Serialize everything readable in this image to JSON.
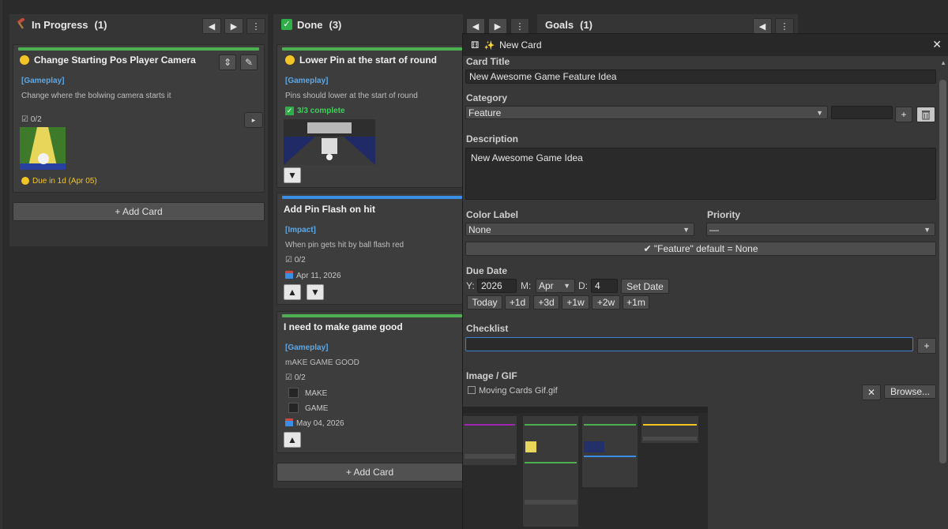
{
  "columns": {
    "in_progress": {
      "icon": "hammer-icon",
      "title": "In Progress",
      "count": "(1)",
      "add_label": "+ Add Card"
    },
    "done": {
      "icon": "checkbox-icon",
      "title": "Done",
      "count": "(3)",
      "add_label": "+ Add Card"
    },
    "goals": {
      "title": "Goals",
      "count": "(1)"
    }
  },
  "nav_glyphs": {
    "left": "◀",
    "right": "▶",
    "menu": "⋮"
  },
  "cards": {
    "camera": {
      "title": "Change Starting Pos Player Camera",
      "tag": "[Gameplay]",
      "desc": "Change where the bolwing camera starts it",
      "checklist": "0/2",
      "due": "Due in 1d (Apr 05)",
      "bar_color": "#4caf50"
    },
    "pin_lower": {
      "title": "Lower Pin at the start of round",
      "tag": "[Gameplay]",
      "desc": "Pins should lower at the start of round",
      "complete": "3/3 complete",
      "bar_color": "#4caf50"
    },
    "pin_flash": {
      "title": "Add Pin Flash on hit",
      "tag": "[Impact]",
      "desc": "When pin gets hit by ball flash red",
      "checklist": "0/2",
      "date": "Apr 11, 2026",
      "bar_color": "#3a8ee6"
    },
    "game_good": {
      "title": "I need to make game good",
      "tag": "[Gameplay]",
      "desc": "mAKE GAME GOOD",
      "checklist": "0/2",
      "items": [
        "MAKE",
        "GAME"
      ],
      "date": "May 04, 2026",
      "bar_color": "#4caf50"
    }
  },
  "modal": {
    "title": "New Card",
    "card_title_label": "Card Title",
    "card_title_value": "New Awesome Game Feature Idea",
    "category_label": "Category",
    "category_value": "Feature",
    "add_glyph": "+",
    "description_label": "Description",
    "description_value": "New Awesome Game Idea",
    "color_label": "Color Label",
    "color_value": "None",
    "priority_label": "Priority",
    "priority_value": "—",
    "default_hint": "✔ \"Feature\" default = None",
    "due_label": "Due Date",
    "y_label": "Y:",
    "year": "2026",
    "m_label": "M:",
    "month": "Apr",
    "d_label": "D:",
    "day": "4",
    "set_date": "Set Date",
    "quick": [
      "Today",
      "+1d",
      "+3d",
      "+1w",
      "+2w",
      "+1m"
    ],
    "checklist_label": "Checklist",
    "image_label": "Image / GIF",
    "file_name": "Moving Cards Gif.gif",
    "browse": "Browse...",
    "close_glyph": "✕"
  }
}
